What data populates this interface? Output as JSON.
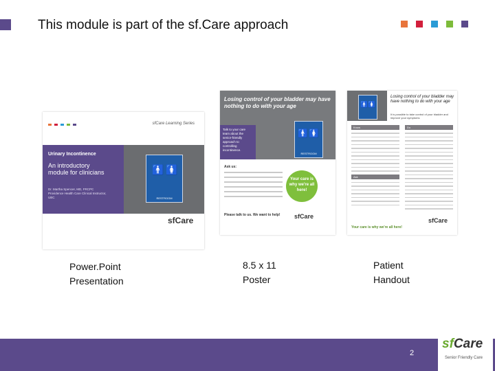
{
  "slide": {
    "title": "This module is part of the sf.Care approach",
    "page_number": "2"
  },
  "colors": {
    "accent_purple": "#5b4a8b",
    "brand_green": "#6aaa2f",
    "dot_colors": [
      "#e8743b",
      "#d21f3c",
      "#2a9bd6",
      "#7dbb3a",
      "#5b4a8b"
    ]
  },
  "thumbnails": {
    "powerpoint": {
      "series": "sfCare Learning Series",
      "band_title": "Urinary Incontinence",
      "subtitle": "An introductory module for clinicians",
      "authors": "Dr. Martha Spencer, MD, FRCPC Providence Health Care Clinical Instructor, UBC",
      "sign_word": "RESTROOM",
      "logo": "sfCare"
    },
    "poster": {
      "headline": "Losing control of your bladder may have nothing to do with your age",
      "purple_text": "Talk to your care team about the senior-friendly approach to controlling incontinence.",
      "ask_us": "Ask us:",
      "circle_text": "Your care is why we're all here!",
      "note": "Please talk to us. We want to help!",
      "sign_word": "RESTROOM",
      "logo": "sfCare"
    },
    "handout": {
      "headline": "Losing control of your bladder may have nothing to do with your age",
      "sub": "It is possible to take control of your bladder and improve your symptoms",
      "col_know": "Know",
      "col_do": "Do",
      "col_ask": "Ask",
      "footer": "Your care is why we're all here!",
      "logo": "sfCare"
    }
  },
  "captions": {
    "powerpoint": [
      "Power.Point",
      "Presentation"
    ],
    "poster": [
      "8.5 x 11",
      "Poster"
    ],
    "handout": [
      "Patient",
      "Handout"
    ]
  },
  "brand": {
    "prefix": "sf",
    "suffix": "Care",
    "tagline": "Senior Friendly Care"
  }
}
